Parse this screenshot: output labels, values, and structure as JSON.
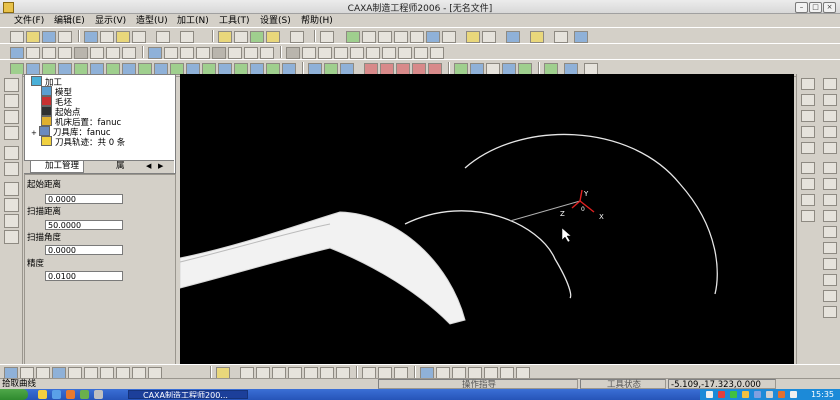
{
  "window": {
    "title": "CAXA制造工程师2006 - [无名文件]"
  },
  "menu": [
    {
      "label": "文件(F)"
    },
    {
      "label": "编辑(E)"
    },
    {
      "label": "显示(V)"
    },
    {
      "label": "造型(U)"
    },
    {
      "label": "加工(N)"
    },
    {
      "label": "工具(T)"
    },
    {
      "label": "设置(S)"
    },
    {
      "label": "帮助(H)"
    }
  ],
  "tree": {
    "items": [
      {
        "label": "加工",
        "icon": "machining-folder-icon"
      },
      {
        "label": "模型",
        "icon": "model-icon"
      },
      {
        "label": "毛坯",
        "icon": "stock-icon"
      },
      {
        "label": "起始点",
        "icon": "start-point-icon"
      },
      {
        "label": "机床后置：fanuc",
        "icon": "machine-postprocessor-icon"
      },
      {
        "label": "刀具库：fanuc",
        "icon": "tool-library-icon"
      },
      {
        "label": "刀具轨迹：共 0 条",
        "icon": "toolpath-folder-icon"
      }
    ]
  },
  "tabs": [
    {
      "label": "加工管理"
    },
    {
      "label": "属"
    }
  ],
  "params": [
    {
      "label": "起始距离",
      "value": "0.0000"
    },
    {
      "label": "扫描距离",
      "value": "50.0000"
    },
    {
      "label": "扫描角度",
      "value": "0.0000"
    },
    {
      "label": "精度",
      "value": "0.0100"
    }
  ],
  "axes": {
    "x": "X",
    "y": "Y",
    "z": "Z",
    "origin": "0"
  },
  "status": {
    "prompt": "拾取曲线",
    "operation_guide": "操作指导",
    "tool_state": "工具状态",
    "coordinates": "-5.109,-17.323,0.000"
  },
  "taskbar": {
    "task": "CAXA制造工程师200...",
    "time": "15:35"
  },
  "colors": {
    "viewport_bg": "#000000",
    "curve": "#ffffff",
    "axis_x": "#e02020",
    "axis_y": "#e02020",
    "taskbar": "#2654b8"
  }
}
